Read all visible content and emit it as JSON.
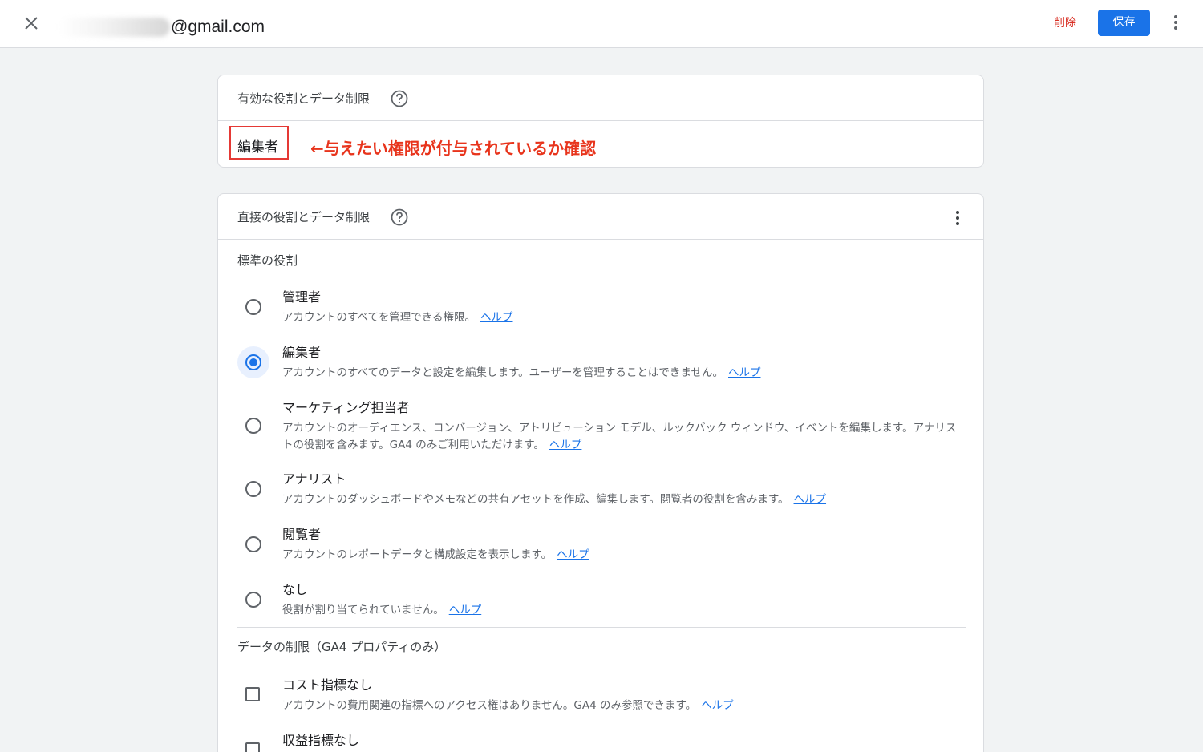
{
  "header": {
    "email": "@gmail.com",
    "delete_label": "削除",
    "save_label": "保存"
  },
  "effective": {
    "title": "有効な役割とデータ制限",
    "role": "編集者",
    "annotation": "←与えたい権限が付与されているか確認"
  },
  "direct": {
    "title": "直接の役割とデータ制限",
    "standard_roles_label": "標準の役割",
    "roles": [
      {
        "title": "管理者",
        "desc": "アカウントのすべてを管理できる権限。",
        "help": "ヘルプ",
        "selected": false
      },
      {
        "title": "編集者",
        "desc": "アカウントのすべてのデータと設定を編集します。ユーザーを管理することはできません。",
        "help": "ヘルプ",
        "selected": true
      },
      {
        "title": "マーケティング担当者",
        "desc": "アカウントのオーディエンス、コンバージョン、アトリビューション モデル、ルックバック ウィンドウ、イベントを編集します。アナリストの役割を含みます。GA4 のみご利用いただけます。",
        "help": "ヘルプ",
        "selected": false
      },
      {
        "title": "アナリスト",
        "desc": "アカウントのダッシュボードやメモなどの共有アセットを作成、編集します。閲覧者の役割を含みます。",
        "help": "ヘルプ",
        "selected": false
      },
      {
        "title": "閲覧者",
        "desc": "アカウントのレポートデータと構成設定を表示します。",
        "help": "ヘルプ",
        "selected": false
      },
      {
        "title": "なし",
        "desc": "役割が割り当てられていません。",
        "help": "ヘルプ",
        "selected": false
      }
    ],
    "data_restrictions_label": "データの制限（GA4 プロパティのみ）",
    "restrictions": [
      {
        "title": "コスト指標なし",
        "desc": "アカウントの費用関連の指標へのアクセス権はありません。GA4 のみ参照できます。",
        "help": "ヘルプ",
        "checked": false
      },
      {
        "title": "収益指標なし",
        "checked": false
      }
    ]
  }
}
